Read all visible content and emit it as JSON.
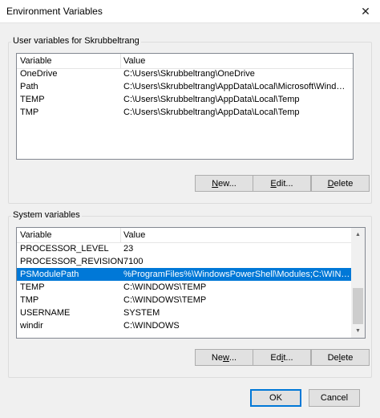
{
  "window": {
    "title": "Environment Variables",
    "close_glyph": "✕"
  },
  "user_vars": {
    "group_label": "User variables for Skrubbeltrang",
    "columns": [
      "Variable",
      "Value"
    ],
    "rows": [
      {
        "name": "OneDrive",
        "value": "C:\\Users\\Skrubbeltrang\\OneDrive"
      },
      {
        "name": "Path",
        "value": "C:\\Users\\Skrubbeltrang\\AppData\\Local\\Microsoft\\WindowsApps;..."
      },
      {
        "name": "TEMP",
        "value": "C:\\Users\\Skrubbeltrang\\AppData\\Local\\Temp"
      },
      {
        "name": "TMP",
        "value": "C:\\Users\\Skrubbeltrang\\AppData\\Local\\Temp"
      }
    ],
    "buttons": {
      "new_u": "N",
      "new_rest": "ew...",
      "edit_u": "E",
      "edit_rest": "dit...",
      "delete_u": "D",
      "delete_rest": "elete"
    }
  },
  "system_vars": {
    "group_label": "System variables",
    "columns": [
      "Variable",
      "Value"
    ],
    "rows": [
      {
        "name": "PROCESSOR_LEVEL",
        "value": "23"
      },
      {
        "name": "PROCESSOR_REVISION",
        "value": "7100"
      },
      {
        "name": "PSModulePath",
        "value": "%ProgramFiles%\\WindowsPowerShell\\Modules;C:\\WINDOWS\\sy..."
      },
      {
        "name": "TEMP",
        "value": "C:\\WINDOWS\\TEMP"
      },
      {
        "name": "TMP",
        "value": "C:\\WINDOWS\\TEMP"
      },
      {
        "name": "USERNAME",
        "value": "SYSTEM"
      },
      {
        "name": "windir",
        "value": "C:\\WINDOWS"
      }
    ],
    "selected_index": 2,
    "buttons": {
      "new_pre": "Ne",
      "new_u": "w",
      "new_rest": "...",
      "edit_pre": "Ed",
      "edit_u": "i",
      "edit_rest": "t...",
      "delete_pre": "De",
      "delete_u": "l",
      "delete_rest": "ete"
    }
  },
  "footer": {
    "ok": "OK",
    "cancel": "Cancel"
  },
  "colors": {
    "selection": "#0078d7",
    "default_button_border": "#0078d7"
  },
  "icons": {
    "scroll_up": "scroll-up-icon",
    "scroll_down": "scroll-down-icon"
  }
}
